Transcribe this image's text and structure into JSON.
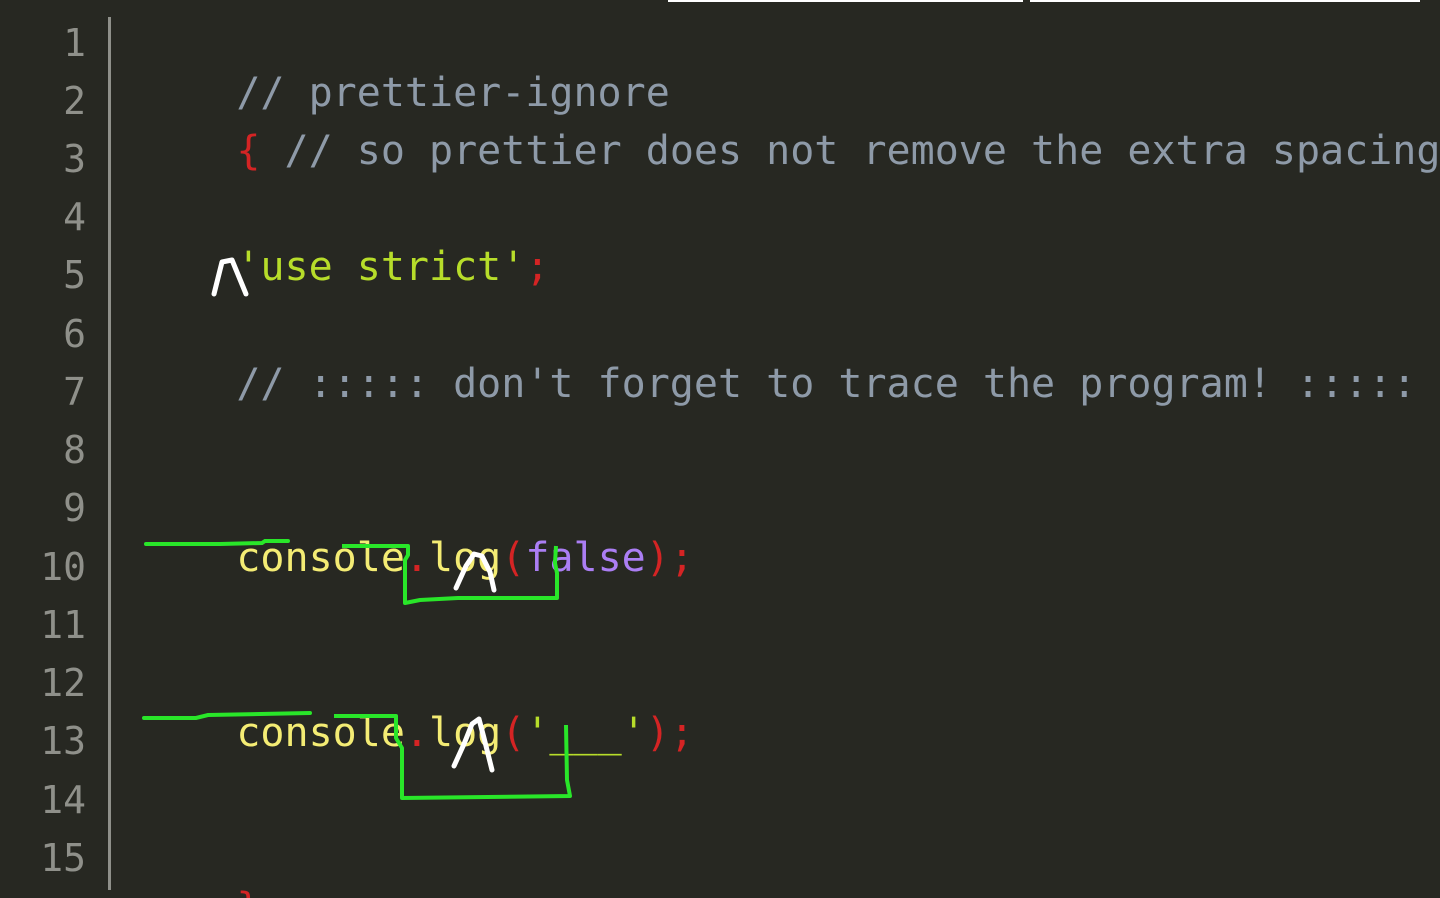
{
  "line_numbers": [
    "1",
    "2",
    "3",
    "4",
    "5",
    "6",
    "7",
    "8",
    "9",
    "10",
    "11",
    "12",
    "13",
    "14",
    "15"
  ],
  "code": {
    "line1": {
      "comment": "// prettier-ignore"
    },
    "line2": {
      "brace": "{",
      "comment": " // so prettier does not remove the extra spacing"
    },
    "line4": {
      "string": "'use strict'",
      "semicolon": ";"
    },
    "line6": {
      "comment": "// ::::: don't forget to trace the program! :::::"
    },
    "line9": {
      "console": "console",
      "dot": ".",
      "log": "log",
      "open": "(",
      "value": "false",
      "close": ")",
      "semicolon": ";"
    },
    "line12": {
      "console": "console",
      "dot": ".",
      "log": "log",
      "open": "(",
      "value": "'___'",
      "close": ")",
      "semicolon": ";"
    },
    "line15": {
      "brace": "}"
    }
  },
  "colors": {
    "background": "#272822",
    "line_number": "#8f908a",
    "comment": "#8e9aa8",
    "brace_and_punctuation": "#d42424",
    "string": "#b7dd2a",
    "identifier": "#f4ec74",
    "boolean": "#ab7ef4",
    "annotation_green": "#29e629",
    "annotation_white": "#ffffff"
  },
  "annotations": {
    "caret_marks": [
      "line5-caret",
      "line10-caret",
      "line13-caret"
    ],
    "underlines": [
      "console-underline-line9",
      "log-bracket-line9",
      "console-underline-line12",
      "log-bracket-line12"
    ]
  }
}
